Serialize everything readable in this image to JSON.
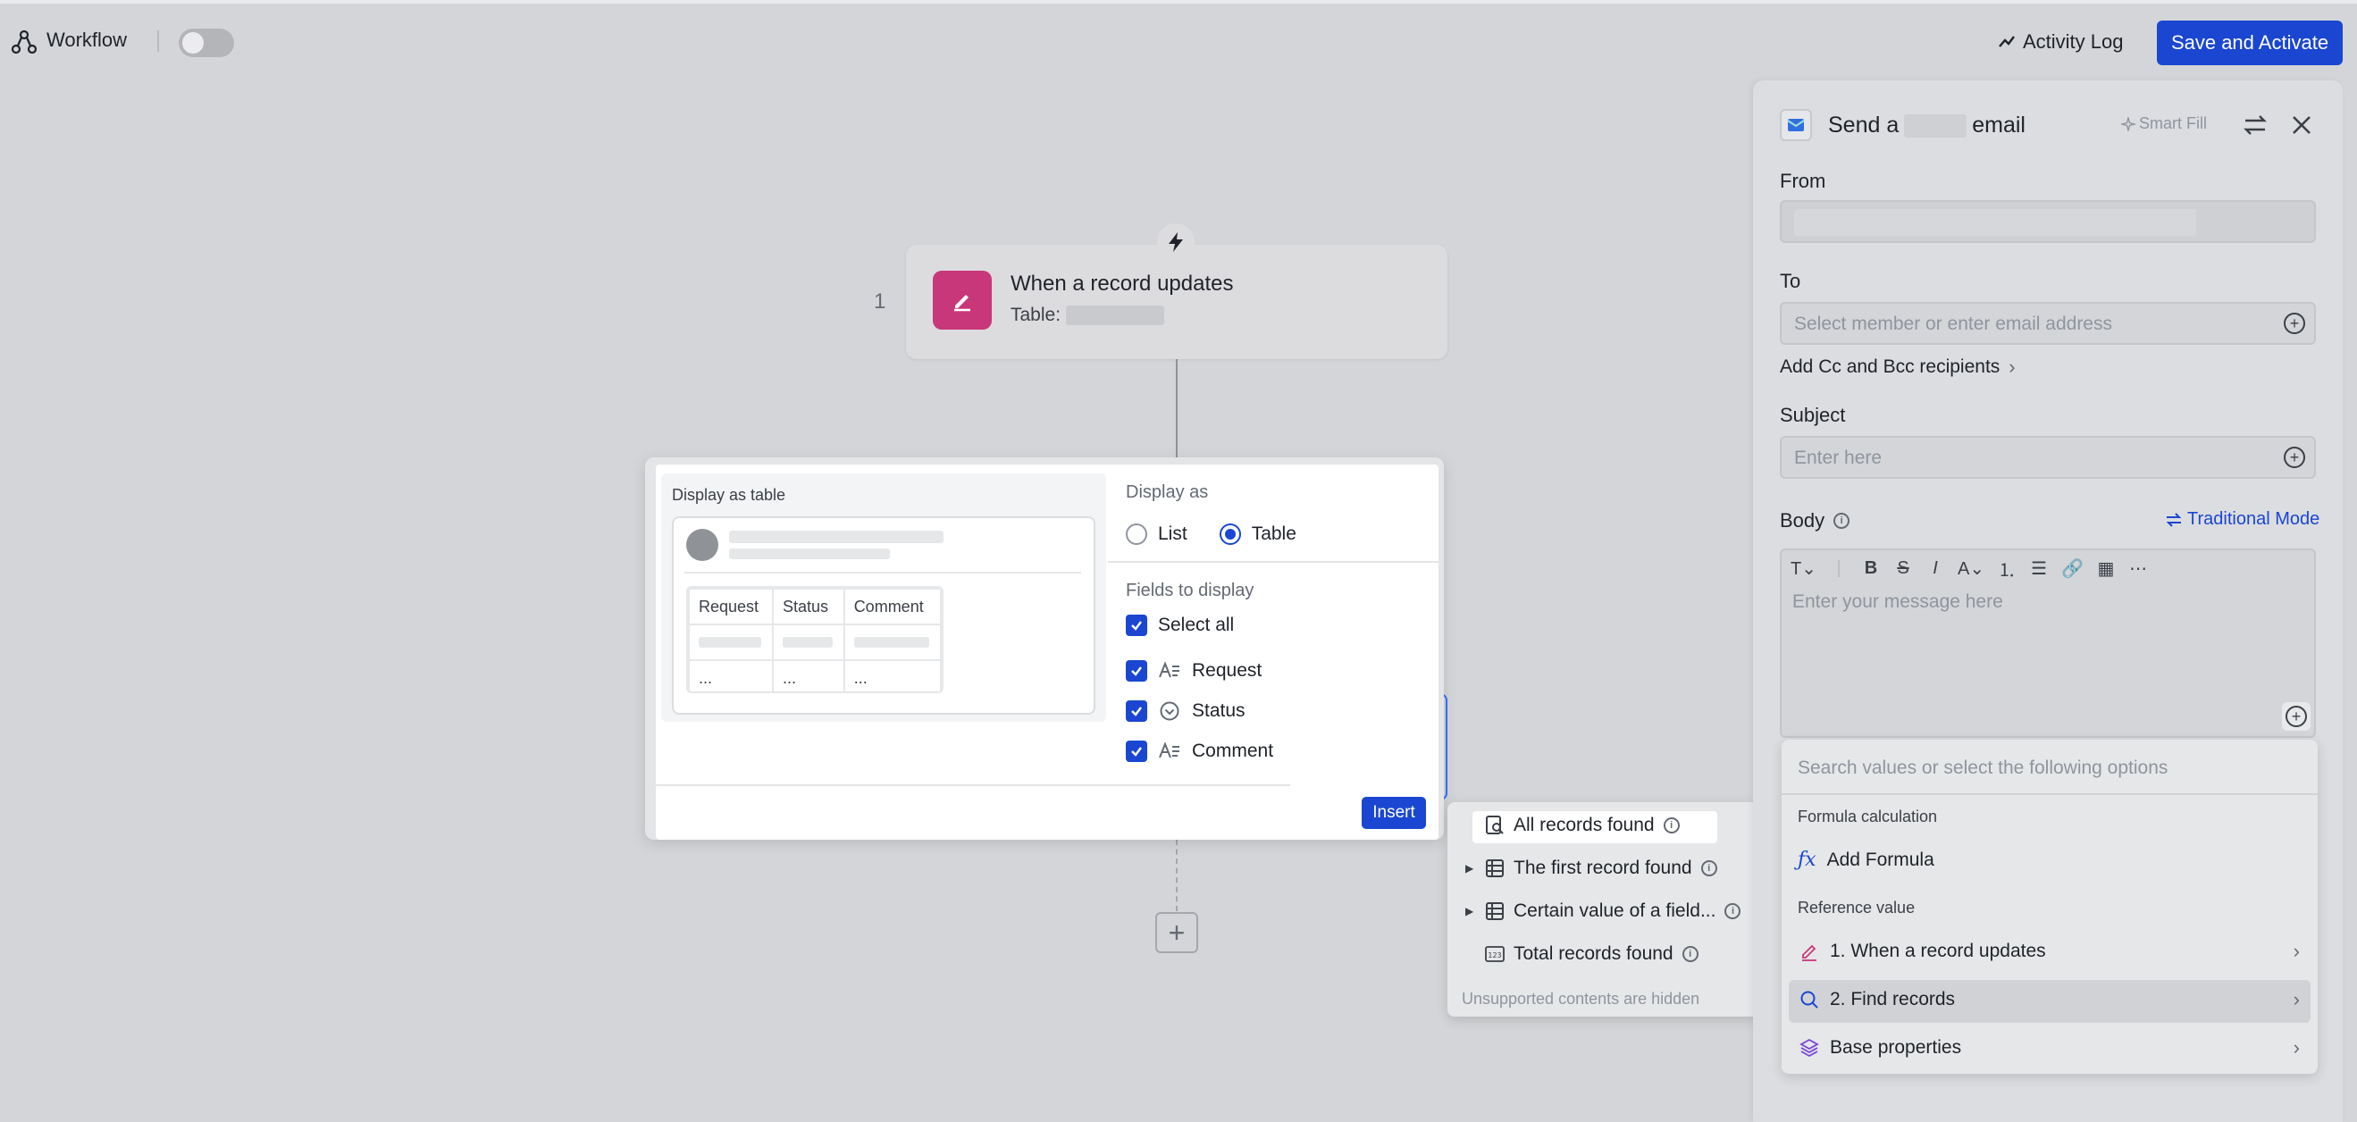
{
  "topbar": {
    "title": "Workflow",
    "activity_log": "Activity Log",
    "save_activate": "Save and Activate"
  },
  "canvas": {
    "step_number": "1",
    "trigger_title": "When a record updates",
    "trigger_table_label": "Table:"
  },
  "display_popup": {
    "preview_label": "Display as table",
    "preview_columns": [
      "Request",
      "Status",
      "Comment"
    ],
    "preview_ellipsis": [
      "...",
      "...",
      "..."
    ],
    "display_as_label": "Display as",
    "options": [
      "List",
      "Table"
    ],
    "selected_option": "Table",
    "fields_label": "Fields to display",
    "select_all": "Select all",
    "fields": [
      {
        "name": "Request",
        "icon": "text-field-icon"
      },
      {
        "name": "Status",
        "icon": "single-select-icon"
      },
      {
        "name": "Comment",
        "icon": "text-field-icon"
      }
    ],
    "insert": "Insert"
  },
  "records_menu": {
    "items": [
      "All records found",
      "The first record found",
      "Certain value of a field...",
      "Total records found"
    ],
    "hidden_note": "Unsupported contents are hidden"
  },
  "panel": {
    "title_prefix": "Send a",
    "title_suffix": "email",
    "smart_fill": "Smart Fill",
    "from_label": "From",
    "to_label": "To",
    "to_placeholder": "Select member or enter email address",
    "cc_bcc": "Add Cc and Bcc recipients",
    "subject_label": "Subject",
    "subject_placeholder": "Enter here",
    "body_label": "Body",
    "traditional_mode": "Traditional Mode",
    "body_placeholder": "Enter your message here"
  },
  "values_menu": {
    "search_placeholder": "Search values or select the following options",
    "formula_section": "Formula calculation",
    "add_formula": "Add Formula",
    "reference_section": "Reference value",
    "references": [
      "1. When a record updates",
      "2. Find records",
      "Base properties"
    ]
  },
  "colors": {
    "accent": "#1a46d1",
    "trigger": "#c8377a",
    "overlay_bg": "#d4d5d8"
  }
}
